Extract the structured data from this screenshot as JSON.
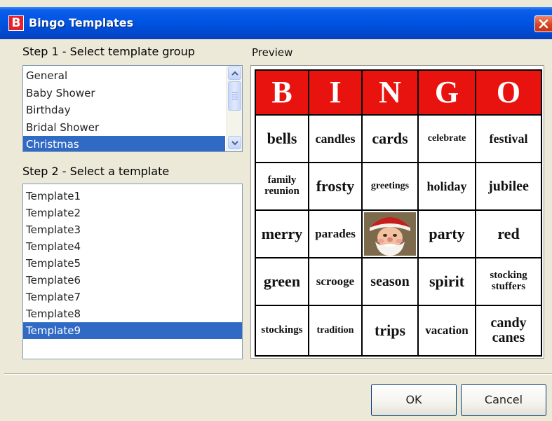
{
  "window": {
    "title": "Bingo Templates",
    "icon_letter": "B"
  },
  "step1": {
    "label": "Step 1 - Select template group",
    "groups": [
      "General",
      "Baby Shower",
      "Birthday",
      "Bridal Shower",
      "Christmas"
    ],
    "selected_index": 4
  },
  "preview": {
    "label": "Preview"
  },
  "step2": {
    "label": "Step 2 - Select a template",
    "templates": [
      "Template1",
      "Template2",
      "Template3",
      "Template4",
      "Template5",
      "Template6",
      "Template7",
      "Template8",
      "Template9"
    ],
    "selected_index": 8
  },
  "card": {
    "header": [
      "B",
      "I",
      "N",
      "G",
      "O"
    ],
    "header_color": "#e8130e",
    "rows": [
      [
        "bells",
        "candles",
        "cards",
        "celebrate",
        "festival"
      ],
      [
        "family reunion",
        "frosty",
        "greetings",
        "holiday",
        "jubilee"
      ],
      [
        "merry",
        "parades",
        "",
        "party",
        "red"
      ],
      [
        "green",
        "scrooge",
        "season",
        "spirit",
        "stocking stuffers"
      ],
      [
        "stockings",
        "tradition",
        "trips",
        "vacation",
        "candy canes"
      ]
    ],
    "free_space_icon": "santa-claus-image"
  },
  "buttons": {
    "ok": "OK",
    "cancel": "Cancel"
  },
  "colors": {
    "selection": "#316ac5",
    "titlebar": "#0054e3",
    "dialog_bg": "#ece9d8"
  }
}
